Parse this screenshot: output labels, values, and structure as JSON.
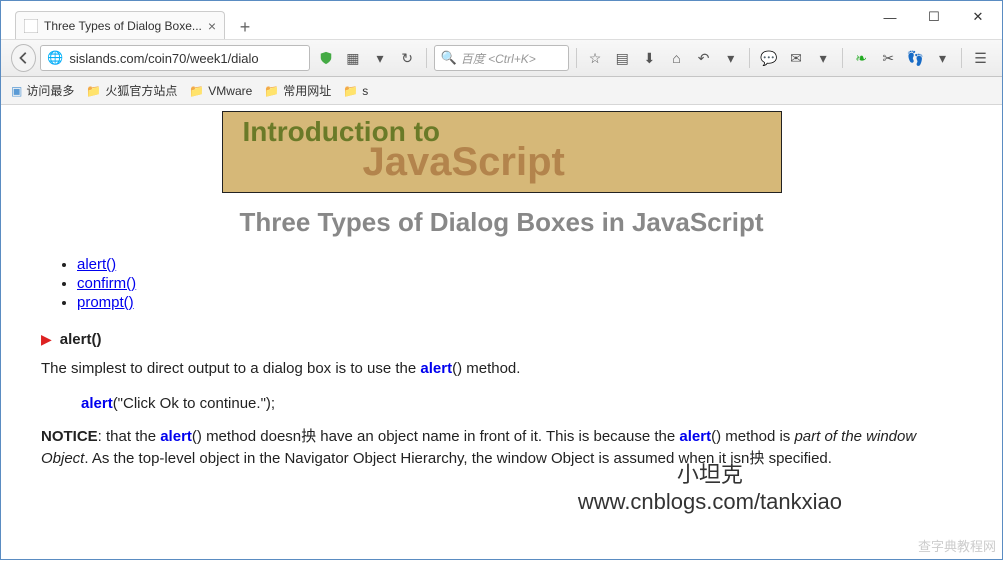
{
  "window": {
    "minimize": "—",
    "maximize": "☐",
    "close": "✕"
  },
  "tabs": {
    "active": {
      "title": "Three Types of Dialog Boxe..."
    },
    "newtab": "+"
  },
  "toolbar": {
    "url": "sislands.com/coin70/week1/dialo",
    "search_placeholder": "百度 <Ctrl+K>"
  },
  "bookmarks": {
    "most": "访问最多",
    "firefox": "火狐官方站点",
    "vmware": "VMware",
    "common": "常用网址",
    "s": "s"
  },
  "page": {
    "banner": {
      "l1": "Introduction to",
      "l2": "JavaScript"
    },
    "title": "Three Types of Dialog Boxes in JavaScript",
    "links": {
      "alert": "alert()",
      "confirm": "confirm()",
      "prompt": "prompt()"
    },
    "section_alert": "alert()",
    "p1_a": "The simplest to direct output to a dialog box is to use the ",
    "p1_kw": "alert",
    "p1_b": "() method.",
    "code_kw": "alert",
    "code_rest": "(\"Click Ok to continue.\");",
    "p2_a": "NOTICE",
    "p2_b": ": that the ",
    "p2_kw1": "alert",
    "p2_c": "() method doesn抰 have an object name in front of it. This is because the ",
    "p2_kw2": "alert",
    "p2_d": "() method is ",
    "p2_em1": "part of the window Object",
    "p2_e": ". As the top-level object in the Navigator Object Hierarchy, the window Object is assumed when it isn抰 specified.",
    "watermark1": "小坦克",
    "watermark2": "www.cnblogs.com/tankxiao",
    "footer_wm": "查字典教程网"
  }
}
